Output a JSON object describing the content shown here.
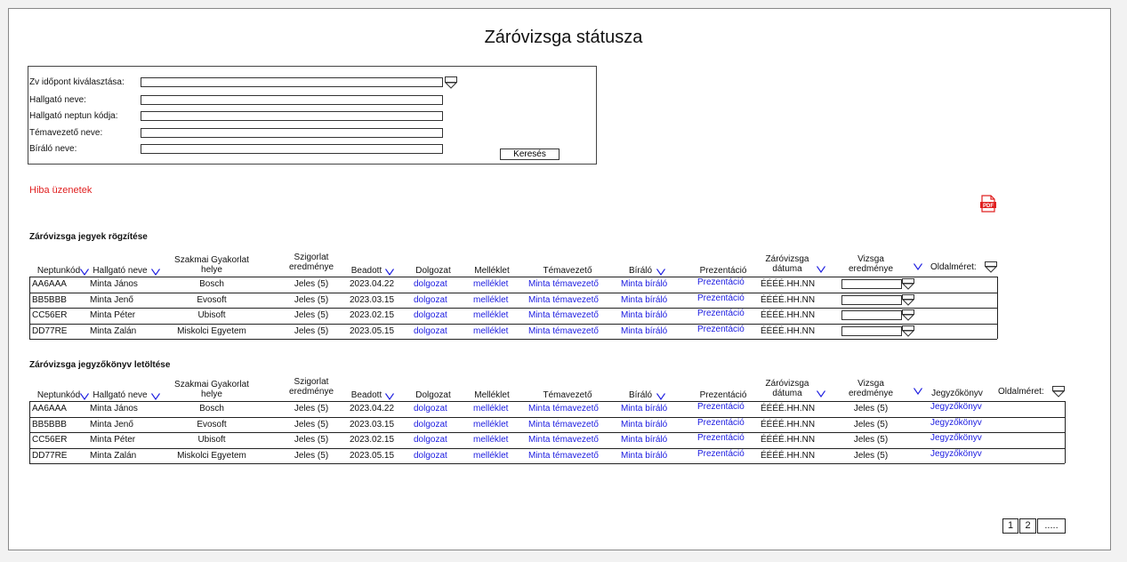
{
  "page": {
    "title": "Záróvizsga státusza"
  },
  "search": {
    "labels": [
      "Zv időpont kiválasztása:",
      "Hallgató neve:",
      "Hallgató neptun kódja:",
      "Témavezető neve:",
      "Bíráló neve:"
    ],
    "button": "Keresés"
  },
  "error_text": "Hiba üzenetek",
  "section1": {
    "title": "Záróvizsga jegyek rögzítése",
    "headers": {
      "neptun": "Neptunkód",
      "name": "Hallgató neve",
      "internship_1": "Szakmai Gyakorlat",
      "internship_2": "helye",
      "exam_1": "Szigorlat",
      "exam_2": "eredménye",
      "submitted": "Beadott",
      "thesis": "Dolgozat",
      "attachment": "Melléklet",
      "supervisor": "Témavezető",
      "reviewer": "Bíráló",
      "presentation": "Prezentáció",
      "date_1": "Záróvizsga",
      "date_2": "dátuma",
      "result_1": "Vizsga",
      "result_2": "eredménye",
      "page_size": "Oldalméret:"
    },
    "rows": [
      {
        "neptun": "AA6AAA",
        "name": "Minta János",
        "internship": "Bosch",
        "exam": "Jeles (5)",
        "submitted": "2023.04.22",
        "thesis": "dolgozat",
        "attachment": "melléklet",
        "supervisor": "Minta témavezető",
        "reviewer": "Minta bíráló",
        "presentation": "Prezentáció",
        "date": "ÉÉÉÉ.HH.NN"
      },
      {
        "neptun": "BB5BBB",
        "name": "Minta Jenő",
        "internship": "Evosoft",
        "exam": "Jeles (5)",
        "submitted": "2023.03.15",
        "thesis": "dolgozat",
        "attachment": "melléklet",
        "supervisor": "Minta témavezető",
        "reviewer": "Minta bíráló",
        "presentation": "Prezentáció",
        "date": "ÉÉÉÉ.HH.NN"
      },
      {
        "neptun": "CC56ER",
        "name": "Minta Péter",
        "internship": "Ubisoft",
        "exam": "Jeles (5)",
        "submitted": "2023.02.15",
        "thesis": "dolgozat",
        "attachment": "melléklet",
        "supervisor": "Minta témavezető",
        "reviewer": "Minta bíráló",
        "presentation": "Prezentáció",
        "date": "ÉÉÉÉ.HH.NN"
      },
      {
        "neptun": "DD77RE",
        "name": "Minta Zalán",
        "internship": "Miskolci Egyetem",
        "exam": "Jeles (5)",
        "submitted": "2023.05.15",
        "thesis": "dolgozat",
        "attachment": "melléklet",
        "supervisor": "Minta témavezető",
        "reviewer": "Minta bíráló",
        "presentation": "Prezentáció",
        "date": "ÉÉÉÉ.HH.NN"
      }
    ]
  },
  "section2": {
    "title": "Záróvizsga jegyzőkönyv letöltése",
    "headers": {
      "neptun": "Neptunkód",
      "name": "Hallgató neve",
      "internship_1": "Szakmai Gyakorlat",
      "internship_2": "helye",
      "exam_1": "Szigorlat",
      "exam_2": "eredménye",
      "submitted": "Beadott",
      "thesis": "Dolgozat",
      "attachment": "Melléklet",
      "supervisor": "Témavezető",
      "reviewer": "Bíráló",
      "presentation": "Prezentáció",
      "date_1": "Záróvizsga",
      "date_2": "dátuma",
      "result_1": "Vizsga",
      "result_2": "eredménye",
      "minutes": "Jegyzőkönyv",
      "page_size": "Oldalméret:"
    },
    "rows": [
      {
        "neptun": "AA6AAA",
        "name": "Minta János",
        "internship": "Bosch",
        "exam": "Jeles (5)",
        "submitted": "2023.04.22",
        "thesis": "dolgozat",
        "attachment": "melléklet",
        "supervisor": "Minta témavezető",
        "reviewer": "Minta bíráló",
        "presentation": "Prezentáció",
        "date": "ÉÉÉÉ.HH.NN",
        "result": "Jeles (5)",
        "minutes": "Jegyzőkönyv"
      },
      {
        "neptun": "BB5BBB",
        "name": "Minta Jenő",
        "internship": "Evosoft",
        "exam": "Jeles (5)",
        "submitted": "2023.03.15",
        "thesis": "dolgozat",
        "attachment": "melléklet",
        "supervisor": "Minta témavezető",
        "reviewer": "Minta bíráló",
        "presentation": "Prezentáció",
        "date": "ÉÉÉÉ.HH.NN",
        "result": "Jeles (5)",
        "minutes": "Jegyzőkönyv"
      },
      {
        "neptun": "CC56ER",
        "name": "Minta Péter",
        "internship": "Ubisoft",
        "exam": "Jeles (5)",
        "submitted": "2023.02.15",
        "thesis": "dolgozat",
        "attachment": "melléklet",
        "supervisor": "Minta témavezető",
        "reviewer": "Minta bíráló",
        "presentation": "Prezentáció",
        "date": "ÉÉÉÉ.HH.NN",
        "result": "Jeles (5)",
        "minutes": "Jegyzőkönyv"
      },
      {
        "neptun": "DD77RE",
        "name": "Minta Zalán",
        "internship": "Miskolci Egyetem",
        "exam": "Jeles (5)",
        "submitted": "2023.05.15",
        "thesis": "dolgozat",
        "attachment": "melléklet",
        "supervisor": "Minta témavezető",
        "reviewer": "Minta bíráló",
        "presentation": "Prezentáció",
        "date": "ÉÉÉÉ.HH.NN",
        "result": "Jeles (5)",
        "minutes": "Jegyzőkönyv"
      }
    ]
  },
  "pagination": [
    "1",
    "2",
    "....."
  ],
  "colors": {
    "link": "#1a1ae0",
    "error": "#e02020",
    "pdf": "#e02020"
  },
  "icons": {
    "pdf": "pdf-icon",
    "sort": "chevron-down-icon",
    "dropdown": "dropdown-triangle-icon"
  }
}
